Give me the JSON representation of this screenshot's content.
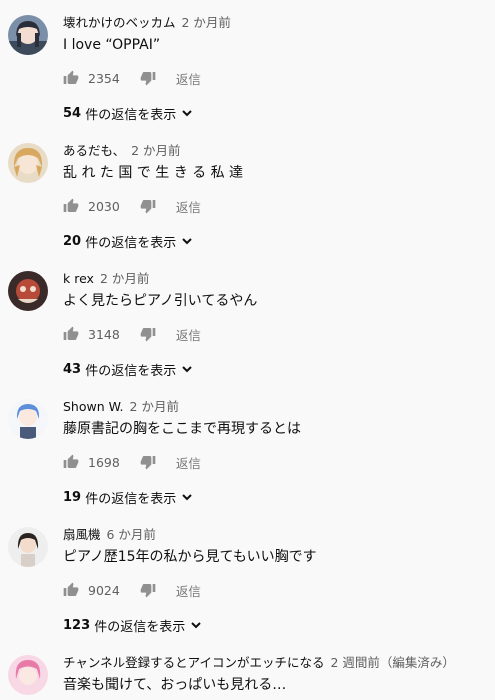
{
  "comments": [
    {
      "author": "壊れかけのベッカム",
      "time": "2 か月前",
      "text": "I love “OPPAI”",
      "likes": "2354",
      "reply": "返信",
      "replies_num": "54",
      "replies_text": "件の返信を表示"
    },
    {
      "author": "あるだも、",
      "time": "2 か月前",
      "text": "乱 れ た 国 で 生 き る 私 達",
      "likes": "2030",
      "reply": "返信",
      "replies_num": "20",
      "replies_text": "件の返信を表示"
    },
    {
      "author": "k rex",
      "time": "2 か月前",
      "text": "よく見たらピアノ引いてるやん",
      "likes": "3148",
      "reply": "返信",
      "replies_num": "43",
      "replies_text": "件の返信を表示"
    },
    {
      "author": "Shown W.",
      "time": "2 か月前",
      "text": "藤原書記の胸をここまで再現するとは",
      "likes": "1698",
      "reply": "返信",
      "replies_num": "19",
      "replies_text": "件の返信を表示"
    },
    {
      "author": "扇風機",
      "time": "6 か月前",
      "text": "ピアノ歴15年の私から見てもいい胸です",
      "likes": "9024",
      "reply": "返信",
      "replies_num": "123",
      "replies_text": "件の返信を表示"
    },
    {
      "author": "チャンネル登録するとアイコンがエッチになる",
      "time": "2 週間前（編集済み）",
      "text": "音楽も聞けて、おっぱいも見れる…"
    }
  ],
  "icons": {
    "like": "thumb-up-icon",
    "dislike": "thumb-down-icon",
    "expand": "chevron-down-icon"
  },
  "colors": {
    "background": "#f9f9f9",
    "text": "#0f0f0f",
    "secondary": "#606060",
    "icon": "#909090"
  }
}
